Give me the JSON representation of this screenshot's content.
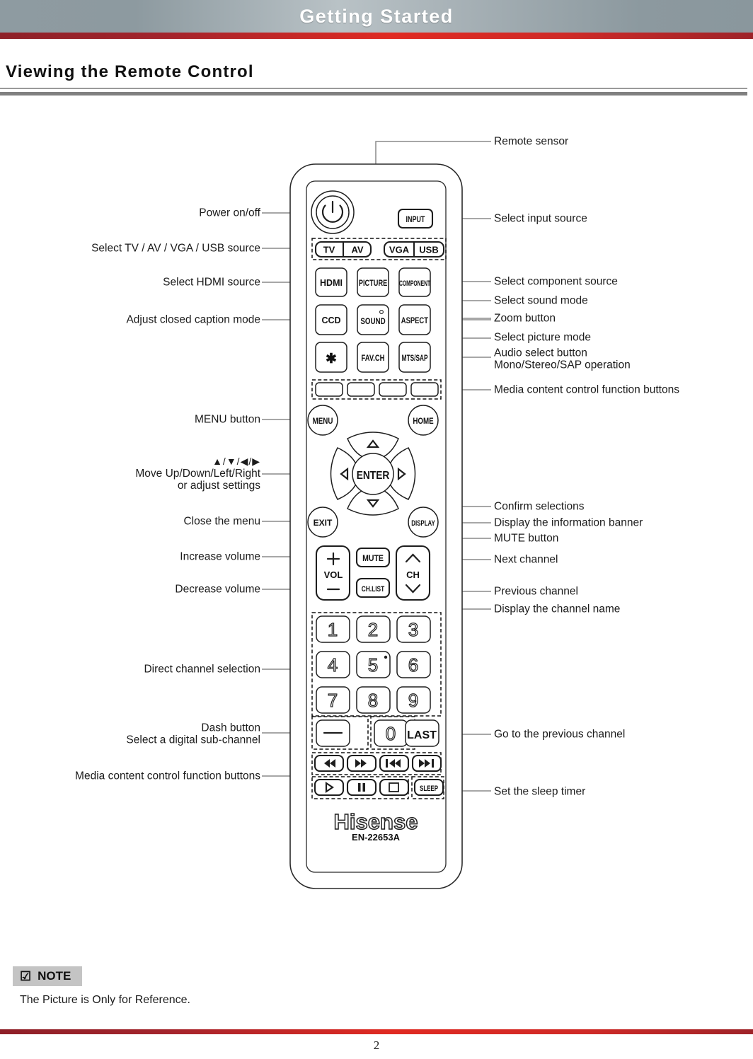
{
  "header": {
    "title": "Getting Started",
    "accent_top": "#8e9ba1",
    "accent_red": "#c0202a"
  },
  "section": {
    "heading": "Viewing the Remote Control"
  },
  "note": {
    "check_icon": "☑",
    "label": "NOTE",
    "text": "The Picture is Only for Reference."
  },
  "footer": {
    "page_number": "2"
  },
  "remote": {
    "brand": "Hisense",
    "model": "EN-22653A",
    "buttons": {
      "power": "⏻",
      "input": "INPUT",
      "tv": "TV",
      "av": "AV",
      "vga": "VGA",
      "usb": "USB",
      "hdmi": "HDMI",
      "picture": "PICTURE",
      "component": "COMPONENT",
      "ccd": "CCD",
      "sound": "SOUND",
      "aspect": "ASPECT",
      "star": "✳",
      "favch": "FAV.CH",
      "mtssap": "MTS/SAP",
      "menu": "MENU",
      "home": "HOME",
      "enter": "ENTER",
      "exit": "EXIT",
      "display": "DISPLAY",
      "vol": "VOL",
      "vol_up": "+",
      "vol_down": "—",
      "mute": "MUTE",
      "chlist": "CH.LIST",
      "ch": "CH",
      "dash": "—",
      "last": "LAST",
      "sleep": "SLEEP",
      "digits": [
        "1",
        "2",
        "3",
        "4",
        "5",
        "6",
        "7",
        "8",
        "9",
        "0"
      ]
    }
  },
  "callouts": {
    "left": [
      {
        "id": "power-on-off",
        "text": "Power on/off"
      },
      {
        "id": "select-tv-av-vga-usb",
        "text": "Select TV / AV / VGA / USB source"
      },
      {
        "id": "select-hdmi",
        "text": "Select HDMI source"
      },
      {
        "id": "adjust-closed-caption",
        "text": "Adjust closed caption mode"
      },
      {
        "id": "menu-button",
        "text": "MENU button"
      },
      {
        "id": "navigation",
        "arrows": "▲/▼/◀/▶",
        "text": "Move Up/Down/Left/Right",
        "sub": "or adjust settings"
      },
      {
        "id": "close-the-menu",
        "text": "Close the menu"
      },
      {
        "id": "increase-volume",
        "text": "Increase volume"
      },
      {
        "id": "decrease-volume",
        "text": "Decrease volume"
      },
      {
        "id": "direct-channel-selection",
        "text": "Direct channel selection"
      },
      {
        "id": "dash-button",
        "text": "Dash button",
        "sub": "Select a digital sub-channel"
      },
      {
        "id": "media-control-bottom",
        "text": "Media content control function buttons"
      }
    ],
    "right": [
      {
        "id": "remote-sensor",
        "text": "Remote sensor"
      },
      {
        "id": "select-input-source",
        "text": "Select input source"
      },
      {
        "id": "select-component",
        "text": "Select component source"
      },
      {
        "id": "select-sound-mode",
        "text": "Select sound mode"
      },
      {
        "id": "zoom-button",
        "text": "Zoom button"
      },
      {
        "id": "select-picture-mode",
        "text": "Select picture mode"
      },
      {
        "id": "audio-select",
        "text": "Audio select button",
        "sub": "Mono/Stereo/SAP operation"
      },
      {
        "id": "media-control-top",
        "text": "Media content control function buttons"
      },
      {
        "id": "confirm-selections",
        "text": "Confirm selections"
      },
      {
        "id": "display-info-banner",
        "text": "Display the information banner"
      },
      {
        "id": "mute-button",
        "text": "MUTE button"
      },
      {
        "id": "next-channel",
        "text": "Next channel"
      },
      {
        "id": "previous-channel",
        "text": "Previous channel"
      },
      {
        "id": "display-channel-name",
        "text": "Display the channel name"
      },
      {
        "id": "go-previous-channel",
        "text": "Go to the previous channel"
      },
      {
        "id": "set-sleep-timer",
        "text": "Set the sleep timer"
      }
    ]
  }
}
